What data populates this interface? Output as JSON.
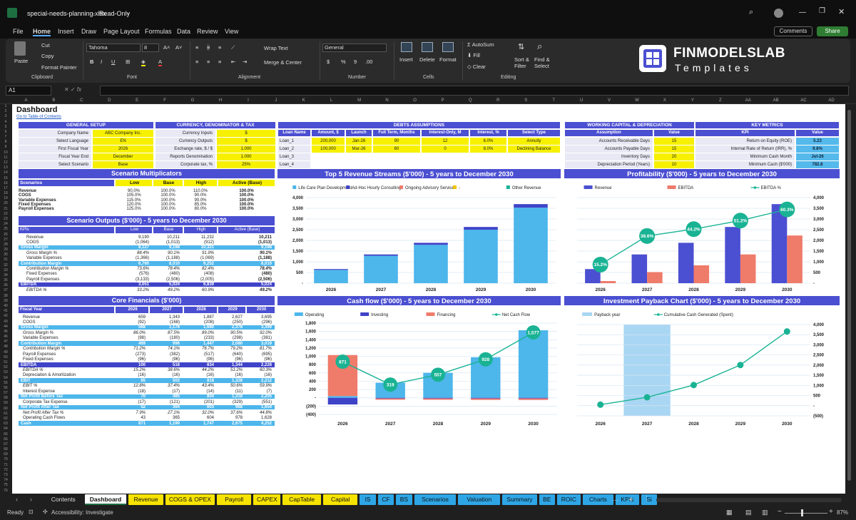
{
  "app": {
    "file": "special-needs-planning.xlsx",
    "mode": "Read-Only"
  },
  "menu": [
    "File",
    "Home",
    "Insert",
    "Draw",
    "Page Layout",
    "Formulas",
    "Data",
    "Review",
    "View"
  ],
  "comments_label": "Comments",
  "share_label": "Share",
  "ribbon": {
    "paste": "Paste",
    "cut": "Cut",
    "copy": "Copy",
    "format_painter": "Format Painter",
    "clipboard": "Clipboard",
    "font_name": "Tahoma",
    "font_size": "8",
    "font": "Font",
    "wrap": "Wrap Text",
    "merge": "Merge & Center",
    "alignment": "Alignment",
    "numfmt": "General",
    "number": "Number",
    "insert": "Insert",
    "delete": "Delete",
    "format": "Format",
    "cells": "Cells",
    "autosum": "AutoSum",
    "fill": "Fill",
    "clear": "Clear",
    "sort": "Sort &",
    "filter": "Filter",
    "find": "Find &",
    "select": "Select",
    "editing": "Editing"
  },
  "logo": {
    "line1": "FINMODELSLAB",
    "line2": "Templates"
  },
  "namebox": "A1",
  "columns": [
    "A",
    "B",
    "C",
    "D",
    "E",
    "F",
    "G",
    "H",
    "I",
    "J",
    "K",
    "L",
    "M",
    "N",
    "O",
    "P",
    "Q",
    "R",
    "S",
    "T",
    "U",
    "V",
    "W",
    "X",
    "Y",
    "Z",
    "AA",
    "AB",
    "AC",
    "AD"
  ],
  "sheet": {
    "title": "Dashboard",
    "toc_link": "Go to Table of Contents"
  },
  "general": {
    "title": "GENERAL SETUP",
    "rows": [
      [
        "Company Name",
        "ABC Company Inc."
      ],
      [
        "Select Language",
        "EN"
      ],
      [
        "First Fiscal Year",
        "2026"
      ],
      [
        "Fiscal Year End",
        "December"
      ],
      [
        "Select Scenario",
        "Base"
      ]
    ]
  },
  "currency": {
    "title": "CURRENCY, DENOMINATOR & TAX",
    "rows": [
      [
        "Currency Inputs",
        "$"
      ],
      [
        "Currency Outputs",
        "$"
      ],
      [
        "Exchange rate, $ / $",
        "1.000"
      ],
      [
        "Reports Denomination",
        "1.000"
      ],
      [
        "Corporate tax, %",
        "25%"
      ]
    ]
  },
  "debts": {
    "title": "DEBTS ASSUMPTIONS",
    "headers": [
      "Loan Name",
      "Amount, $",
      "Launch",
      "Full Term, Months",
      "Interest-Only, M",
      "Interest, %",
      "Select Type"
    ],
    "rows": [
      [
        "Loan_1",
        "200,000",
        "Jan-26",
        "90",
        "12",
        "6.0%",
        "Annuity"
      ],
      [
        "Loan_2",
        "100,000",
        "Mar-26",
        "60",
        "0",
        "8.0%",
        "Declining Balance"
      ],
      [
        "Loan_3",
        "",
        "",
        "",
        "",
        "",
        ""
      ],
      [
        "Loan_4",
        "",
        "",
        "",
        "",
        "",
        ""
      ]
    ]
  },
  "wc": {
    "title": "WORKING CAPITAL & DEPRECIATION",
    "headers": [
      "Assumption",
      "Value"
    ],
    "rows": [
      [
        "Accounts Receivable Days",
        "15"
      ],
      [
        "Accounts Payable Days",
        "15"
      ],
      [
        "Inventory Days",
        "20"
      ],
      [
        "Depreciation Period (Years)",
        "10"
      ]
    ]
  },
  "kpi": {
    "title": "KEY METRICS",
    "headers": [
      "KPI",
      "Value"
    ],
    "rows": [
      [
        "Return on Equity (ROE)",
        "5.23"
      ],
      [
        "Internal Rate of Return (IRR), %",
        "9.8%"
      ],
      [
        "Minimum Cash Month",
        "Jul-26"
      ],
      [
        "Minimum Cash ($'000)",
        "782.8"
      ]
    ]
  },
  "scen": {
    "title": "Scenario Multiplicators",
    "headers": [
      "Scenarios",
      "Low",
      "Base",
      "High",
      "Active (Base)"
    ],
    "rows": [
      [
        "Revenue",
        "90.0%",
        "100.0%",
        "110.0%",
        "100.0%"
      ],
      [
        "COGS",
        "105.0%",
        "100.0%",
        "90.0%",
        "100.0%"
      ],
      [
        "Variable Expenses",
        "115.0%",
        "100.0%",
        "90.0%",
        "100.0%"
      ],
      [
        "Fixed Expenses",
        "120.0%",
        "100.0%",
        "85.0%",
        "100.0%"
      ],
      [
        "Payroll Expenses",
        "125.0%",
        "100.0%",
        "80.0%",
        "100.0%"
      ]
    ]
  },
  "outputs": {
    "title": "Scenario Outputs ($'000) - 5 years to December 2030",
    "headers": [
      "KPIs",
      "Low",
      "Base",
      "High",
      "Active (Base)"
    ],
    "rows": [
      [
        "Revenue",
        "9,190",
        "10,211",
        "11,232",
        "10,211"
      ],
      [
        "COGS",
        "(1,064)",
        "(1,013)",
        "(912)",
        "(1,013)"
      ],
      [
        "Gross Margin",
        "8,127",
        "9,198",
        "10,321",
        "9,198"
      ],
      [
        "Gross Margin %",
        "88.4%",
        "90.1%",
        "91.9%",
        "90.1%"
      ],
      [
        "Variable Expenses",
        "(1,366)",
        "(1,188)",
        "(1,069)",
        "(1,188)"
      ],
      [
        "Contribution Margin",
        "6,760",
        "8,010",
        "9,252",
        "8,010"
      ],
      [
        "Contribution Margin %",
        "73.6%",
        "78.4%",
        "82.4%",
        "78.4%"
      ],
      [
        "Fixed Expenses",
        "(576)",
        "(480)",
        "(408)",
        "(480)"
      ],
      [
        "Payroll Expenses",
        "(3,133)",
        "(2,506)",
        "(2,005)",
        "(2,506)"
      ],
      [
        "EBITDA",
        "3,051",
        "5,024",
        "6,839",
        "5,024"
      ],
      [
        "EBITDA %",
        "33.2%",
        "49.2%",
        "60.9%",
        "49.2%"
      ]
    ]
  },
  "core": {
    "title": "Core Financials ($'000)",
    "headers": [
      "Fiscal Year",
      "2026",
      "2027",
      "2028",
      "2029",
      "2030"
    ],
    "rows": [
      [
        "Revenue",
        "659",
        "1,343",
        "1,887",
        "2,627",
        "3,695"
      ],
      [
        "COGS",
        "(92)",
        "(168)",
        "(208)",
        "(250)",
        "(296)"
      ],
      [
        "Gross Margin",
        "568",
        "1,176",
        "1,680",
        "2,378",
        "3,399"
      ],
      [
        "Gross Margin %",
        "86.0%",
        "87.5%",
        "89.0%",
        "90.5%",
        "92.0%"
      ],
      [
        "Variable Expenses",
        "(98)",
        "(180)",
        "(233)",
        "(298)",
        "(381)"
      ],
      [
        "Contribution Margin",
        "469",
        "996",
        "1,447",
        "2,080",
        "3,019"
      ],
      [
        "Contribution Margin %",
        "71.2%",
        "74.1%",
        "76.7%",
        "79.2%",
        "81.7%"
      ],
      [
        "Payroll Expenses",
        "(273)",
        "(382)",
        "(517)",
        "(640)",
        "(695)"
      ],
      [
        "Fixed Expenses",
        "(96)",
        "(96)",
        "(96)",
        "(96)",
        "(96)"
      ],
      [
        "EBITDA",
        "100",
        "518",
        "834",
        "1,344",
        "2,228"
      ],
      [
        "EBITDA %",
        "15.2%",
        "38.6%",
        "44.2%",
        "51.2%",
        "60.3%"
      ],
      [
        "Depreciation & Amortization",
        "(16)",
        "(16)",
        "(16)",
        "(16)",
        "(16)"
      ],
      [
        "EBIT",
        "85",
        "502",
        "818",
        "1,328",
        "2,212"
      ],
      [
        "EBIT %",
        "12.8%",
        "37.4%",
        "43.4%",
        "50.6%",
        "59.9%"
      ],
      [
        "Interest Expense",
        "(18)",
        "(17)",
        "(14)",
        "(11)",
        "(7)"
      ],
      [
        "Net Profit Before Tax",
        "70",
        "485",
        "804",
        "1,318",
        "2,205"
      ],
      [
        "Corporate Tax Expense",
        "(17)",
        "(121)",
        "(201)",
        "(329)",
        "(551)"
      ],
      [
        "Net Profit After Tax",
        "52",
        "364",
        "603",
        "988",
        "1,654"
      ],
      [
        "Net Profit After Tax %",
        "7.9%",
        "27.1%",
        "32.0%",
        "37.6%",
        "44.8%"
      ],
      [
        "Operating Cash Flows",
        "43",
        "365",
        "604",
        "978",
        "1,628"
      ],
      [
        "Cash",
        "871",
        "1,190",
        "1,747",
        "2,675",
        "4,252"
      ]
    ]
  },
  "chart_data": [
    {
      "type": "bar",
      "title": "Top 5 Revenue Streams ($'000) - 5 years to December 2030",
      "categories": [
        "2026",
        "2027",
        "2028",
        "2029",
        "2030"
      ],
      "series": [
        {
          "name": "Life Care Plan Development",
          "values": [
            620,
            1280,
            1790,
            2500,
            3530
          ]
        },
        {
          "name": "Ad-Hoc Hourly Consulting",
          "values": [
            40,
            63,
            97,
            127,
            165
          ]
        },
        {
          "name": "Ongoing Advisory Services",
          "values": [
            0,
            0,
            0,
            0,
            0
          ]
        },
        {
          "name": "-",
          "values": [
            0,
            0,
            0,
            0,
            0
          ]
        },
        {
          "name": "Other Revenue",
          "values": [
            0,
            0,
            0,
            0,
            0
          ]
        }
      ],
      "ylim": [
        0,
        4000
      ],
      "yticks": [
        "-",
        "500",
        "1,000",
        "1,500",
        "2,000",
        "2,500",
        "3,000",
        "3,500",
        "4,000"
      ],
      "colors": [
        "#4db6eb",
        "#3f43c8",
        "#ef7b6b",
        "#f2c100",
        "#19b394"
      ]
    },
    {
      "type": "bar+line",
      "title": "Profitability ($'000) - 5 years to December 2030",
      "categories": [
        "2026",
        "2027",
        "2028",
        "2029",
        "2030"
      ],
      "series": [
        {
          "name": "Revenue",
          "values": [
            659,
            1343,
            1887,
            2627,
            3695
          ]
        },
        {
          "name": "EBITDA",
          "values": [
            100,
            518,
            834,
            1344,
            2228
          ]
        },
        {
          "name": "EBITDA %",
          "values": [
            15.2,
            38.6,
            44.2,
            51.2,
            60.3
          ]
        }
      ],
      "ylim": [
        0,
        4000
      ],
      "yticks": [
        "-",
        "500",
        "1,000",
        "1,500",
        "2,000",
        "2,500",
        "3,000",
        "3,500",
        "4,000"
      ],
      "point_labels": [
        "15.2%",
        "38.6%",
        "44.2%",
        "51.2%",
        "60.3%"
      ],
      "colors": [
        "#4b4fd1",
        "#ef7b6b",
        "#19b394"
      ]
    },
    {
      "type": "bar+line",
      "title": "Cash flow ($'000) - 5 years to December 2030",
      "categories": [
        "2026",
        "2027",
        "2028",
        "2029",
        "2030"
      ],
      "series": [
        {
          "name": "Operating",
          "values": [
            43,
            365,
            604,
            978,
            1628
          ]
        },
        {
          "name": "Investing",
          "values": [
            -160,
            -15,
            -15,
            -15,
            -15
          ]
        },
        {
          "name": "Financing",
          "values": [
            988,
            -31,
            -32,
            -35,
            -36
          ]
        },
        {
          "name": "Net Cash Flow",
          "values": [
            871,
            319,
            557,
            928,
            1577
          ]
        }
      ],
      "ylim": [
        -400,
        1800
      ],
      "yticks": [
        "(400)",
        "(200)",
        "-",
        "200",
        "400",
        "600",
        "800",
        "1,000",
        "1,200",
        "1,400",
        "1,600",
        "1,800"
      ],
      "point_labels": [
        "871",
        "319",
        "557",
        "928",
        "1,577"
      ],
      "colors": [
        "#4db6eb",
        "#3f43c8",
        "#ef7b6b",
        "#19b394"
      ]
    },
    {
      "type": "line",
      "title": "Investment Payback Chart ($'000) - 5 years to December 2030",
      "categories": [
        "2026",
        "2027",
        "2028",
        "2029",
        "2030"
      ],
      "series": [
        {
          "name": "Payback year",
          "values": [
            0,
            1,
            0,
            0,
            0
          ]
        },
        {
          "name": "Cumulative Cash Generated (Spent)",
          "values": [
            52,
            416,
            1019,
            2007,
            3661
          ]
        }
      ],
      "ylim": [
        -500,
        4000
      ],
      "yticks": [
        "(500)",
        "-",
        "500",
        "1,000",
        "1,500",
        "2,000",
        "2,500",
        "3,000",
        "3,500",
        "4,000"
      ],
      "colors": [
        "#a9d6f3",
        "#19b394"
      ]
    }
  ],
  "tabs": [
    {
      "label": "Contents",
      "color": "none"
    },
    {
      "label": "Dashboard",
      "color": "active"
    },
    {
      "label": "Revenue",
      "color": "#f7e300"
    },
    {
      "label": "COGS & OPEX",
      "color": "#f7e300"
    },
    {
      "label": "Payroll",
      "color": "#f7e300"
    },
    {
      "label": "CAPEX",
      "color": "#f7e300"
    },
    {
      "label": "CapTable",
      "color": "#f7e300"
    },
    {
      "label": "Capital",
      "color": "#f7e300"
    },
    {
      "label": "IS",
      "color": "#2ea6e6"
    },
    {
      "label": "CF",
      "color": "#2ea6e6"
    },
    {
      "label": "BS",
      "color": "#2ea6e6"
    },
    {
      "label": "Scenarios",
      "color": "#2ea6e6"
    },
    {
      "label": "Valuation",
      "color": "#2ea6e6"
    },
    {
      "label": "Summary",
      "color": "#2ea6e6"
    },
    {
      "label": "BE",
      "color": "#2ea6e6"
    },
    {
      "label": "ROIC",
      "color": "#2ea6e6"
    },
    {
      "label": "Charts",
      "color": "#2ea6e6"
    },
    {
      "label": "KPIs",
      "color": "#2ea6e6"
    },
    {
      "label": "Si",
      "color": "#2ea6e6"
    }
  ],
  "status": {
    "ready": "Ready",
    "accessibility": "Accessibility: Investigate",
    "zoom": "87%"
  }
}
